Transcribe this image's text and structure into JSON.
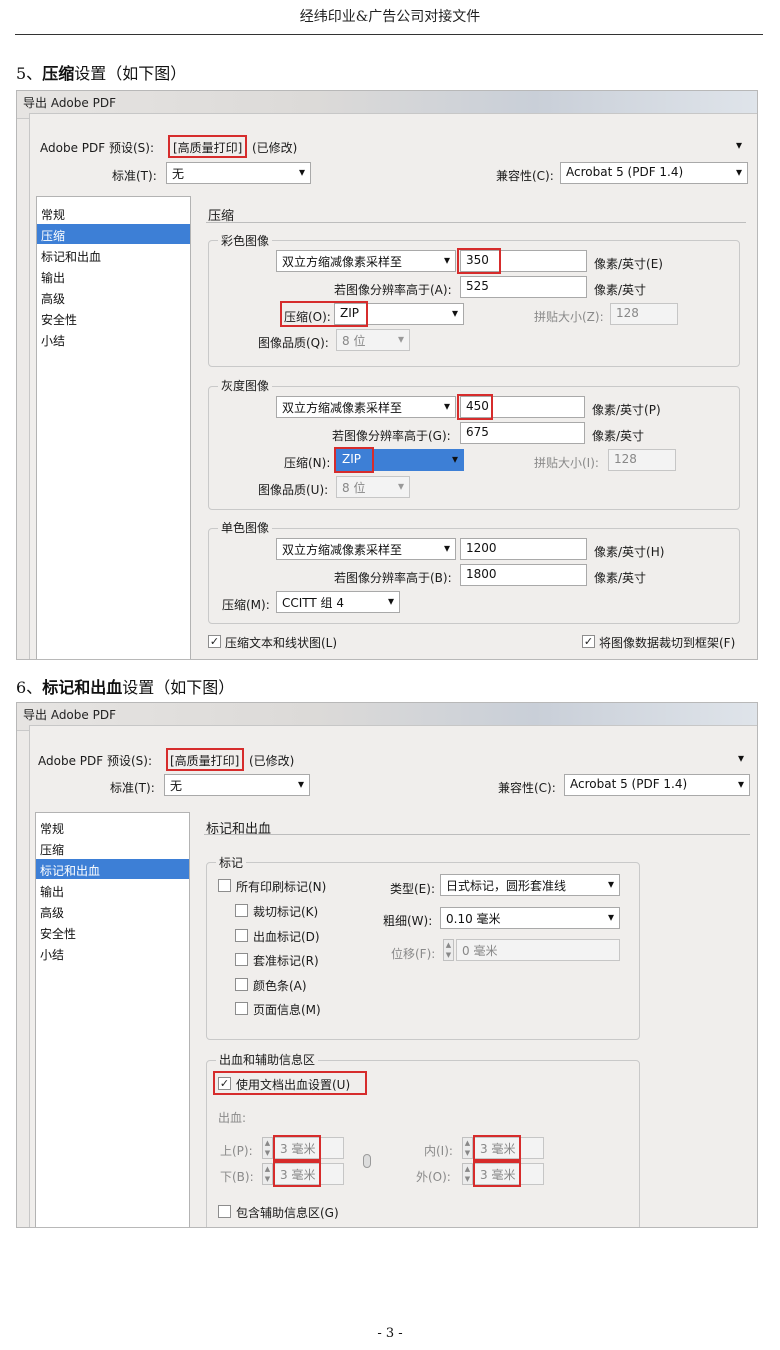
{
  "doc": {
    "header": "经纬印业&广告公司对接文件",
    "page_number": "- 3 -"
  },
  "section5": {
    "number": "5、",
    "bold": "压缩",
    "rest": "设置（如下图）"
  },
  "section6": {
    "number": "6、",
    "bold": "标记和出血",
    "rest": "设置（如下图）"
  },
  "dialog_common": {
    "window_title": "导出 Adobe PDF",
    "preset_label": "Adobe PDF 预设(S):",
    "preset_value": "[高质量打印]",
    "preset_modified": "(已修改)",
    "standard_label": "标准(T):",
    "standard_value": "无",
    "compat_label": "兼容性(C):",
    "compat_value": "Acrobat 5 (PDF 1.4)",
    "nav": [
      "常规",
      "压缩",
      "标记和出血",
      "输出",
      "高级",
      "安全性",
      "小结"
    ]
  },
  "compression": {
    "heading": "压缩",
    "color": {
      "title": "彩色图像",
      "method": "双立方缩减像素采样至",
      "ppi": "350",
      "ppi_unit": "像素/英寸(E)",
      "above_label": "若图像分辨率高于(A):",
      "above_value": "525",
      "above_unit": "像素/英寸",
      "comp_label": "压缩(O):",
      "comp_value": "ZIP",
      "tile_label": "拼贴大小(Z):",
      "tile_value": "128",
      "quality_label": "图像品质(Q):",
      "quality_value": "8 位"
    },
    "gray": {
      "title": "灰度图像",
      "method": "双立方缩减像素采样至",
      "ppi": "450",
      "ppi_unit": "像素/英寸(P)",
      "above_label": "若图像分辨率高于(G):",
      "above_value": "675",
      "above_unit": "像素/英寸",
      "comp_label": "压缩(N):",
      "comp_value": "ZIP",
      "tile_label": "拼贴大小(I):",
      "tile_value": "128",
      "quality_label": "图像品质(U):",
      "quality_value": "8 位"
    },
    "mono": {
      "title": "单色图像",
      "method": "双立方缩减像素采样至",
      "ppi": "1200",
      "ppi_unit": "像素/英寸(H)",
      "above_label": "若图像分辨率高于(B):",
      "above_value": "1800",
      "above_unit": "像素/英寸",
      "comp_label": "压缩(M):",
      "comp_value": "CCITT 组 4"
    },
    "compress_text": "压缩文本和线状图(L)",
    "crop_data": "将图像数据裁切到框架(F)"
  },
  "marks": {
    "heading": "标记和出血",
    "group_title": "标记",
    "all_marks": "所有印刷标记(N)",
    "items": [
      "裁切标记(K)",
      "出血标记(D)",
      "套准标记(R)",
      "颜色条(A)",
      "页面信息(M)"
    ],
    "type_label": "类型(E):",
    "type_value": "日式标记，圆形套准线",
    "weight_label": "粗细(W):",
    "weight_value": "0.10 毫米",
    "offset_label": "位移(F):",
    "offset_value": "0 毫米",
    "bleed_group_title": "出血和辅助信息区",
    "use_doc_bleed": "使用文档出血设置(U)",
    "bleed_label": "出血:",
    "top_label": "上(P):",
    "top_value": "3 毫米",
    "bottom_label": "下(B):",
    "bottom_value": "3 毫米",
    "inside_label": "内(I):",
    "inside_value": "3 毫米",
    "outside_label": "外(O):",
    "outside_value": "3 毫米",
    "include_slug": "包含辅助信息区(G)"
  },
  "colors": {
    "highlight": "#d62c2c",
    "selection": "#3d7fd6"
  }
}
